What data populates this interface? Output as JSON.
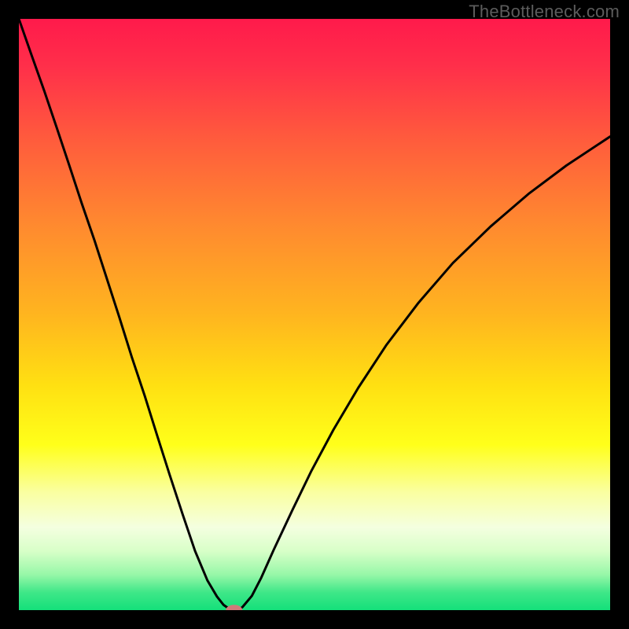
{
  "watermark": "TheBottleneck.com",
  "chart_data": {
    "type": "line",
    "title": "",
    "xlabel": "",
    "ylabel": "",
    "xlim": [
      0,
      100
    ],
    "ylim": [
      0,
      100
    ],
    "gradient_stops": [
      {
        "offset": 0.0,
        "color": "#ff1a4b"
      },
      {
        "offset": 0.08,
        "color": "#ff2f4a"
      },
      {
        "offset": 0.2,
        "color": "#ff5a3d"
      },
      {
        "offset": 0.35,
        "color": "#ff8a2f"
      },
      {
        "offset": 0.5,
        "color": "#ffb51f"
      },
      {
        "offset": 0.62,
        "color": "#ffe012"
      },
      {
        "offset": 0.72,
        "color": "#ffff1a"
      },
      {
        "offset": 0.8,
        "color": "#faffa0"
      },
      {
        "offset": 0.86,
        "color": "#f4ffe0"
      },
      {
        "offset": 0.9,
        "color": "#d8ffc8"
      },
      {
        "offset": 0.94,
        "color": "#97f7a8"
      },
      {
        "offset": 0.97,
        "color": "#3fe788"
      },
      {
        "offset": 1.0,
        "color": "#14e07a"
      }
    ],
    "curve": {
      "x": [
        0.0,
        2.1,
        4.3,
        6.4,
        8.5,
        10.6,
        12.8,
        14.9,
        17.0,
        19.1,
        21.3,
        23.4,
        25.5,
        27.7,
        29.8,
        31.9,
        33.5,
        34.6,
        35.6,
        36.2,
        36.7,
        37.2,
        37.8,
        39.4,
        41.0,
        43.1,
        46.3,
        49.5,
        53.2,
        57.4,
        62.2,
        67.6,
        73.4,
        79.8,
        86.2,
        92.6,
        100.0
      ],
      "y": [
        100.0,
        94.0,
        87.8,
        81.6,
        75.3,
        68.9,
        62.5,
        56.0,
        49.5,
        42.8,
        36.2,
        29.5,
        22.9,
        16.2,
        10.0,
        5.0,
        2.3,
        0.9,
        0.2,
        0.0,
        0.0,
        0.1,
        0.5,
        2.4,
        5.5,
        10.2,
        17.0,
        23.6,
        30.5,
        37.6,
        44.9,
        52.0,
        58.7,
        64.9,
        70.4,
        75.2,
        80.1
      ]
    },
    "marker": {
      "x": 36.4,
      "y": 0.0,
      "rx": 1.4,
      "ry": 0.9,
      "color": "#d07a7a"
    }
  }
}
